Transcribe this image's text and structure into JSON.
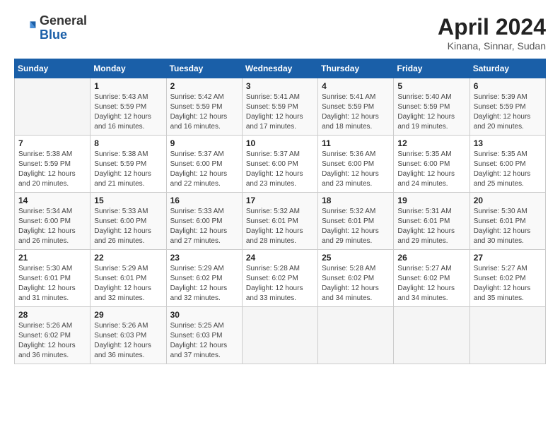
{
  "header": {
    "logo_general": "General",
    "logo_blue": "Blue",
    "month": "April 2024",
    "location": "Kinana, Sinnar, Sudan"
  },
  "columns": [
    "Sunday",
    "Monday",
    "Tuesday",
    "Wednesday",
    "Thursday",
    "Friday",
    "Saturday"
  ],
  "weeks": [
    [
      {
        "day": "",
        "detail": ""
      },
      {
        "day": "1",
        "detail": "Sunrise: 5:43 AM\nSunset: 5:59 PM\nDaylight: 12 hours\nand 16 minutes."
      },
      {
        "day": "2",
        "detail": "Sunrise: 5:42 AM\nSunset: 5:59 PM\nDaylight: 12 hours\nand 16 minutes."
      },
      {
        "day": "3",
        "detail": "Sunrise: 5:41 AM\nSunset: 5:59 PM\nDaylight: 12 hours\nand 17 minutes."
      },
      {
        "day": "4",
        "detail": "Sunrise: 5:41 AM\nSunset: 5:59 PM\nDaylight: 12 hours\nand 18 minutes."
      },
      {
        "day": "5",
        "detail": "Sunrise: 5:40 AM\nSunset: 5:59 PM\nDaylight: 12 hours\nand 19 minutes."
      },
      {
        "day": "6",
        "detail": "Sunrise: 5:39 AM\nSunset: 5:59 PM\nDaylight: 12 hours\nand 20 minutes."
      }
    ],
    [
      {
        "day": "7",
        "detail": "Sunrise: 5:38 AM\nSunset: 5:59 PM\nDaylight: 12 hours\nand 20 minutes."
      },
      {
        "day": "8",
        "detail": "Sunrise: 5:38 AM\nSunset: 5:59 PM\nDaylight: 12 hours\nand 21 minutes."
      },
      {
        "day": "9",
        "detail": "Sunrise: 5:37 AM\nSunset: 6:00 PM\nDaylight: 12 hours\nand 22 minutes."
      },
      {
        "day": "10",
        "detail": "Sunrise: 5:37 AM\nSunset: 6:00 PM\nDaylight: 12 hours\nand 23 minutes."
      },
      {
        "day": "11",
        "detail": "Sunrise: 5:36 AM\nSunset: 6:00 PM\nDaylight: 12 hours\nand 23 minutes."
      },
      {
        "day": "12",
        "detail": "Sunrise: 5:35 AM\nSunset: 6:00 PM\nDaylight: 12 hours\nand 24 minutes."
      },
      {
        "day": "13",
        "detail": "Sunrise: 5:35 AM\nSunset: 6:00 PM\nDaylight: 12 hours\nand 25 minutes."
      }
    ],
    [
      {
        "day": "14",
        "detail": "Sunrise: 5:34 AM\nSunset: 6:00 PM\nDaylight: 12 hours\nand 26 minutes."
      },
      {
        "day": "15",
        "detail": "Sunrise: 5:33 AM\nSunset: 6:00 PM\nDaylight: 12 hours\nand 26 minutes."
      },
      {
        "day": "16",
        "detail": "Sunrise: 5:33 AM\nSunset: 6:00 PM\nDaylight: 12 hours\nand 27 minutes."
      },
      {
        "day": "17",
        "detail": "Sunrise: 5:32 AM\nSunset: 6:01 PM\nDaylight: 12 hours\nand 28 minutes."
      },
      {
        "day": "18",
        "detail": "Sunrise: 5:32 AM\nSunset: 6:01 PM\nDaylight: 12 hours\nand 29 minutes."
      },
      {
        "day": "19",
        "detail": "Sunrise: 5:31 AM\nSunset: 6:01 PM\nDaylight: 12 hours\nand 29 minutes."
      },
      {
        "day": "20",
        "detail": "Sunrise: 5:30 AM\nSunset: 6:01 PM\nDaylight: 12 hours\nand 30 minutes."
      }
    ],
    [
      {
        "day": "21",
        "detail": "Sunrise: 5:30 AM\nSunset: 6:01 PM\nDaylight: 12 hours\nand 31 minutes."
      },
      {
        "day": "22",
        "detail": "Sunrise: 5:29 AM\nSunset: 6:01 PM\nDaylight: 12 hours\nand 32 minutes."
      },
      {
        "day": "23",
        "detail": "Sunrise: 5:29 AM\nSunset: 6:02 PM\nDaylight: 12 hours\nand 32 minutes."
      },
      {
        "day": "24",
        "detail": "Sunrise: 5:28 AM\nSunset: 6:02 PM\nDaylight: 12 hours\nand 33 minutes."
      },
      {
        "day": "25",
        "detail": "Sunrise: 5:28 AM\nSunset: 6:02 PM\nDaylight: 12 hours\nand 34 minutes."
      },
      {
        "day": "26",
        "detail": "Sunrise: 5:27 AM\nSunset: 6:02 PM\nDaylight: 12 hours\nand 34 minutes."
      },
      {
        "day": "27",
        "detail": "Sunrise: 5:27 AM\nSunset: 6:02 PM\nDaylight: 12 hours\nand 35 minutes."
      }
    ],
    [
      {
        "day": "28",
        "detail": "Sunrise: 5:26 AM\nSunset: 6:02 PM\nDaylight: 12 hours\nand 36 minutes."
      },
      {
        "day": "29",
        "detail": "Sunrise: 5:26 AM\nSunset: 6:03 PM\nDaylight: 12 hours\nand 36 minutes."
      },
      {
        "day": "30",
        "detail": "Sunrise: 5:25 AM\nSunset: 6:03 PM\nDaylight: 12 hours\nand 37 minutes."
      },
      {
        "day": "",
        "detail": ""
      },
      {
        "day": "",
        "detail": ""
      },
      {
        "day": "",
        "detail": ""
      },
      {
        "day": "",
        "detail": ""
      }
    ]
  ]
}
